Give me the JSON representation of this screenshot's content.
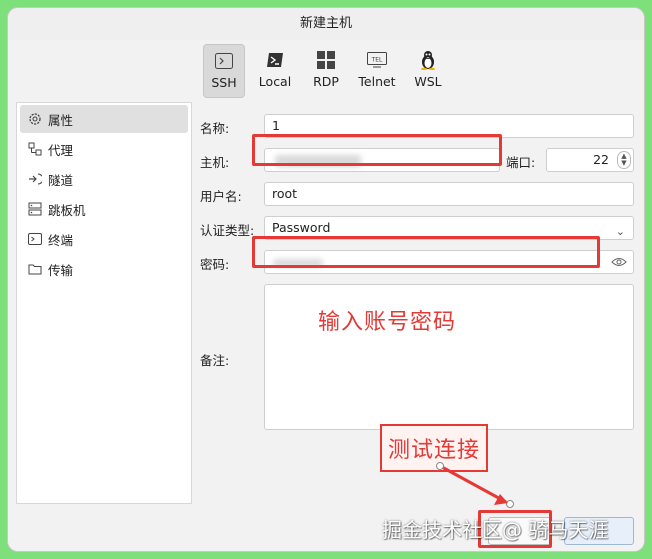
{
  "window": {
    "title": "新建主机"
  },
  "protocols": [
    {
      "label": "SSH",
      "icon": "terminal-icon",
      "active": true
    },
    {
      "label": "Local",
      "icon": "powershell-icon",
      "active": false
    },
    {
      "label": "RDP",
      "icon": "windows-icon",
      "active": false
    },
    {
      "label": "Telnet",
      "icon": "tel-icon",
      "active": false
    },
    {
      "label": "WSL",
      "icon": "linux-penguin-icon",
      "active": false
    }
  ],
  "sidebar": {
    "items": [
      {
        "label": "属性",
        "icon": "gear-icon",
        "active": true
      },
      {
        "label": "代理",
        "icon": "proxy-icon",
        "active": false
      },
      {
        "label": "隧道",
        "icon": "tunnel-icon",
        "active": false
      },
      {
        "label": "跳板机",
        "icon": "jump-server-icon",
        "active": false
      },
      {
        "label": "终端",
        "icon": "terminal-icon",
        "active": false
      },
      {
        "label": "传输",
        "icon": "folder-icon",
        "active": false
      }
    ]
  },
  "form": {
    "name_label": "名称:",
    "name_value": "1",
    "host_label": "主机:",
    "port_label": "端口:",
    "port_value": "22",
    "user_label": "用户名:",
    "user_value": "root",
    "auth_label": "认证类型:",
    "auth_value": "Password",
    "password_label": "密码:",
    "notes_label": "备注:"
  },
  "annotations": {
    "enter_credentials": "输入账号密码",
    "test_connection": "测试连接"
  },
  "watermark": "掘金技术社区@ 骑马天涯",
  "colors": {
    "highlight": "#e53935",
    "background": "#7ee07a"
  }
}
